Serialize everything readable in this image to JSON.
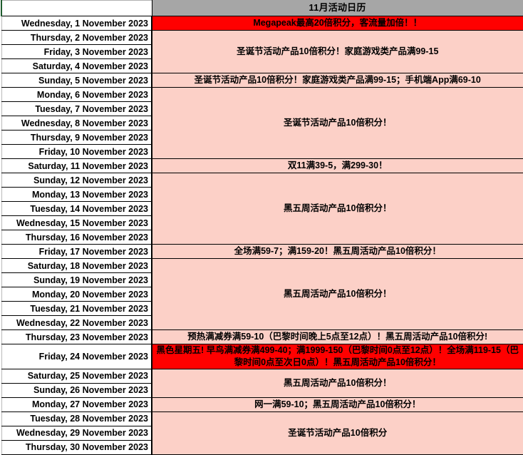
{
  "sheet": {
    "header": {
      "blank_label": "",
      "title": "11月活动日历"
    },
    "colors": {
      "header_grey": "#A6A6A6",
      "promo_pink": "#FCD0C7",
      "promo_red": "#FF0000",
      "grid_black": "#000000",
      "text_black": "#000000"
    },
    "columns": [
      "",
      "11月活动日历"
    ],
    "rows": [
      {
        "date": "Wednesday, 1 November 2023",
        "group_start": true,
        "rowspan": 1,
        "fill": "red",
        "promo": "Megapeak最高20倍积分，客流量加倍！！"
      },
      {
        "date": "Thursday, 2 November 2023",
        "group_start": true,
        "rowspan": 3,
        "fill": "pink",
        "promo": "圣诞节活动产品10倍积分！家庭游戏类产品满99-15"
      },
      {
        "date": "Friday, 3 November 2023",
        "group_start": false
      },
      {
        "date": "Saturday, 4 November 2023",
        "group_start": false
      },
      {
        "date": "Sunday, 5 November 2023",
        "group_start": true,
        "rowspan": 1,
        "fill": "pink",
        "promo": "圣诞节活动产品10倍积分！家庭游戏类产品满99-15；手机端App满69-10"
      },
      {
        "date": "Monday, 6 November 2023",
        "group_start": true,
        "rowspan": 5,
        "fill": "pink",
        "promo": "圣诞节活动产品10倍积分！"
      },
      {
        "date": "Tuesday, 7 November 2023",
        "group_start": false
      },
      {
        "date": "Wednesday, 8 November 2023",
        "group_start": false
      },
      {
        "date": "Thursday, 9 November 2023",
        "group_start": false
      },
      {
        "date": "Friday, 10 November 2023",
        "group_start": false
      },
      {
        "date": "Saturday, 11 November 2023",
        "group_start": true,
        "rowspan": 1,
        "fill": "pink",
        "promo": "双11满39-5，满299-30！"
      },
      {
        "date": "Sunday, 12 November 2023",
        "group_start": true,
        "rowspan": 5,
        "fill": "pink",
        "promo": "黑五周活动产品10倍积分！"
      },
      {
        "date": "Monday, 13 November 2023",
        "group_start": false
      },
      {
        "date": "Tuesday, 14 November 2023",
        "group_start": false
      },
      {
        "date": "Wednesday, 15 November 2023",
        "group_start": false
      },
      {
        "date": "Thursday, 16 November 2023",
        "group_start": false
      },
      {
        "date": "Friday, 17 November 2023",
        "group_start": true,
        "rowspan": 1,
        "fill": "pink",
        "promo": "全场满59-7；满159-20！黑五周活动产品10倍积分！"
      },
      {
        "date": "Saturday, 18 November 2023",
        "group_start": true,
        "rowspan": 5,
        "fill": "pink",
        "promo": "黑五周活动产品10倍积分！"
      },
      {
        "date": "Sunday, 19 November 2023",
        "group_start": false
      },
      {
        "date": "Monday, 20 November 2023",
        "group_start": false
      },
      {
        "date": "Tuesday, 21 November 2023",
        "group_start": false
      },
      {
        "date": "Wednesday, 22 November 2023",
        "group_start": false
      },
      {
        "date": "Thursday, 23 November 2023",
        "group_start": true,
        "rowspan": 1,
        "fill": "pink",
        "promo": "预热满减券满59-10（巴黎时间晚上5点至12点）！黑五周活动产品10倍积分!"
      },
      {
        "date": "Friday, 24 November 2023",
        "group_start": true,
        "rowspan": 1,
        "fill": "red",
        "promo": "黑色星期五! 早鸟满减券满499-40；满1999-150（巴黎时间0点至12点）！全场满119-15（巴黎时间0点至次日0点）！黑五周活动产品10倍积分！"
      },
      {
        "date": "Saturday, 25 November 2023",
        "group_start": true,
        "rowspan": 2,
        "fill": "pink",
        "promo": "黑五周活动产品10倍积分！"
      },
      {
        "date": "Sunday, 26 November 2023",
        "group_start": false
      },
      {
        "date": "Monday, 27 November 2023",
        "group_start": true,
        "rowspan": 1,
        "fill": "pink",
        "promo": "网一满59-10；黑五周活动产品10倍积分！"
      },
      {
        "date": "Tuesday, 28 November 2023",
        "group_start": true,
        "rowspan": 3,
        "fill": "pink",
        "promo": "圣诞节活动产品10倍积分"
      },
      {
        "date": "Wednesday, 29 November 2023",
        "group_start": false
      },
      {
        "date": "Thursday, 30 November 2023",
        "group_start": false
      }
    ]
  }
}
